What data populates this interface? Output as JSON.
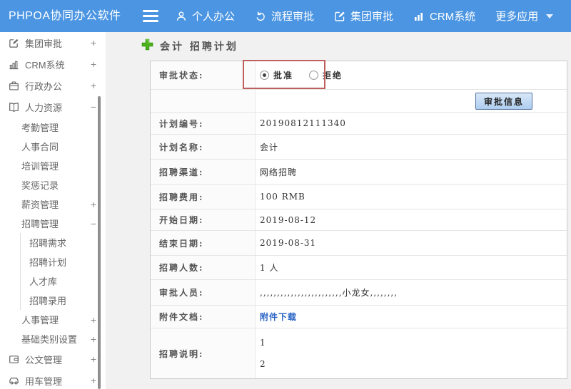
{
  "colors": {
    "topbar-blue": "#4b95e2",
    "highlight-red": "#c0605e",
    "link-blue": "#2a64c5",
    "plus-green": "#4db31c",
    "button-face": "#aecdf0",
    "button-face-top": "#d9e8f8",
    "button-border": "#54719c"
  },
  "topbar": {
    "brand": "PHPOA协同办公软件",
    "menu_icon": "hamburger-icon",
    "nav": [
      {
        "label": "个人办公",
        "icon": "user-icon"
      },
      {
        "label": "流程审批",
        "icon": "process-icon"
      },
      {
        "label": "集团审批",
        "icon": "edit-icon"
      },
      {
        "label": "CRM系统",
        "icon": "bar-chart-icon"
      },
      {
        "label": "更多应用",
        "icon": "caret-down-icon"
      }
    ]
  },
  "sidebar": {
    "items": [
      {
        "label": "集团审批",
        "icon": "edit-square-icon",
        "toggle": "+",
        "level": 1
      },
      {
        "label": "CRM系统",
        "icon": "bar-chart-icon",
        "toggle": "+",
        "level": 1
      },
      {
        "label": "行政办公",
        "icon": "briefcase-icon",
        "toggle": "+",
        "level": 1
      },
      {
        "label": "人力资源",
        "icon": "book-icon",
        "toggle": "−",
        "level": 1,
        "expanded": true
      },
      {
        "label": "考勤管理",
        "level": 2
      },
      {
        "label": "人事合同",
        "level": 2
      },
      {
        "label": "培训管理",
        "level": 2
      },
      {
        "label": "奖惩记录",
        "level": 2
      },
      {
        "label": "薪资管理",
        "toggle": "+",
        "level": 2
      },
      {
        "label": "招聘管理",
        "toggle": "−",
        "level": 2,
        "expanded": true
      },
      {
        "label": "招聘需求",
        "level": 3
      },
      {
        "label": "招聘计划",
        "level": 3
      },
      {
        "label": "人才库",
        "level": 3
      },
      {
        "label": "招聘录用",
        "level": 3
      },
      {
        "label": "人事管理",
        "toggle": "+",
        "level": 2
      },
      {
        "label": "基础类别设置",
        "toggle": "+",
        "level": 2
      },
      {
        "label": "公文管理",
        "icon": "document-icon",
        "toggle": "+",
        "level": 1
      },
      {
        "label": "用车管理",
        "icon": "car-icon",
        "toggle": "+",
        "level": 1
      }
    ]
  },
  "main": {
    "page_title": "会计 招聘计划",
    "title_icon": "plus-icon",
    "approval": {
      "label": "审批状态:",
      "options": [
        {
          "label": "批准",
          "selected": true
        },
        {
          "label": "拒绝",
          "selected": false
        }
      ]
    },
    "approve_button": "审批信息",
    "fields": [
      {
        "label": "计划编号:",
        "value": "20190812111340"
      },
      {
        "label": "计划名称:",
        "value": "会计"
      },
      {
        "label": "招聘渠道:",
        "value": "网络招聘"
      },
      {
        "label": "招聘费用:",
        "value": "100 RMB"
      },
      {
        "label": "开始日期:",
        "value": "2019-08-12"
      },
      {
        "label": "结束日期:",
        "value": "2019-08-31"
      },
      {
        "label": "招聘人数:",
        "value": "1 人"
      },
      {
        "label": "审批人员:",
        "value": ",,,,,,,,,,,,,,,,,,,,,,,,小龙女,,,,,,,,"
      },
      {
        "label": "附件文档:",
        "value": "附件下载",
        "type": "link"
      },
      {
        "label": "招聘说明:",
        "line1": "1",
        "line2": "2",
        "type": "multiline"
      }
    ]
  }
}
